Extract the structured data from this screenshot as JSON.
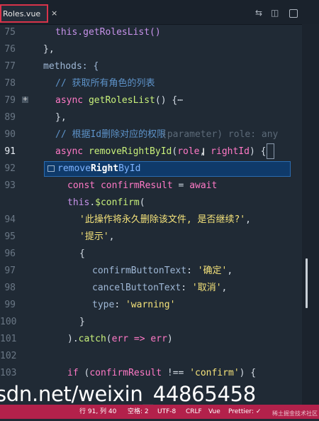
{
  "tab": {
    "filename": "Roles.vue",
    "close": "×"
  },
  "editor_code": {
    "l75": "this.getRolesList()",
    "l76": "},",
    "l77": "methods: {",
    "l78": "// 获取所有角色的列表",
    "l79_kw": "async",
    "l79_fn": "getRolesList",
    "l79_rest": "() {⋯",
    "l89": "},",
    "l90": "// 根据Id删除对应的权限",
    "l90_hint": "(parameter) role: any",
    "l91_kw": "async",
    "l91_fn": "removeRightById",
    "l91_p1": "role",
    "l91_p2": "rightId",
    "l91_end": "{",
    "suggestion_pre": "remove",
    "suggestion_bold": "Right",
    "suggestion_post": "ById",
    "l93_kw": "const",
    "l93_var": "confirmResult",
    "l93_eq": " = ",
    "l93_await": "await",
    "l94a_this": "this",
    "l94a_fn": "$confirm",
    "l94_str": "'此操作将永久删除该文件, 是否继续?'",
    "l95_str": "'提示'",
    "l96": "{",
    "l97_key": "confirmButtonText",
    "l97_val": "'确定'",
    "l98_key": "cancelButtonText",
    "l98_val": "'取消'",
    "l99_key": "type",
    "l99_val": "'warning'",
    "l100": "}",
    "l101_catch": "catch",
    "l101_err": "err",
    "l101_arrow": " => ",
    "l101_err2": "err",
    "l103_if": "if",
    "l103_var": "confirmResult",
    "l103_op": " !== ",
    "l103_str": "'confirm'",
    "l103_end": ") {"
  },
  "line_numbers": [
    "75",
    "76",
    "77",
    "78",
    "79",
    "89",
    "90",
    "91",
    "92",
    "93",
    "",
    "94",
    "95",
    "96",
    "97",
    "98",
    "99",
    "100",
    "101",
    "102",
    "103"
  ],
  "watermark": "sdn.net/weixin_44865458",
  "status": {
    "position": "行 91, 列 40",
    "spaces": "空格: 2",
    "encoding": "UTF-8",
    "eol": "CRLF",
    "language": "Vue",
    "prettier": "Prettier: ✓",
    "badge": "稀土掘金技术社区"
  },
  "icons": [
    "split-editor-icon",
    "compare-icon",
    "more-icon",
    "expand-icon",
    "cursor-icon"
  ]
}
